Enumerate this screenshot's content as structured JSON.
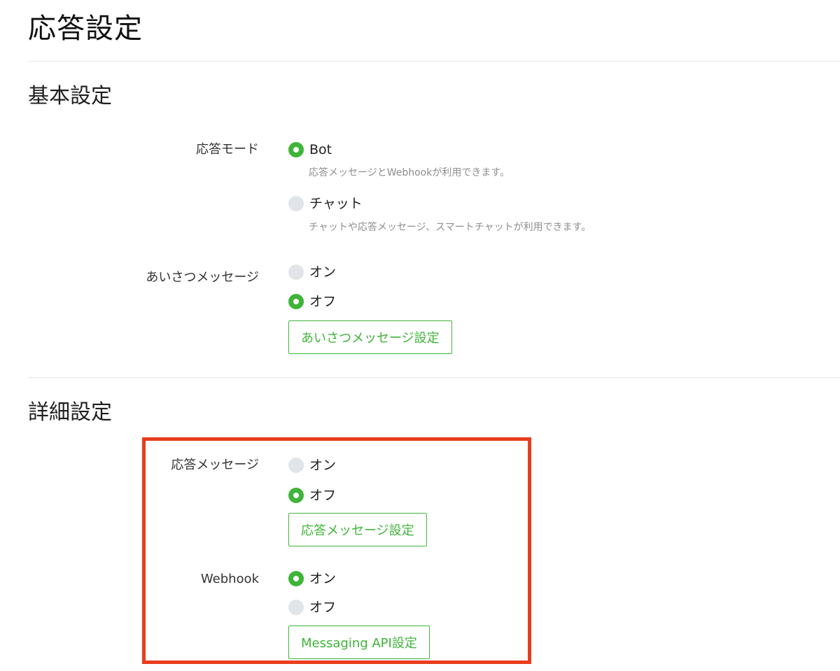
{
  "page": {
    "title": "応答設定"
  },
  "basic": {
    "title": "基本設定",
    "response_mode": {
      "label": "応答モード",
      "options": [
        {
          "label": "Bot",
          "selected": true,
          "hint": "応答メッセージとWebhookが利用できます。"
        },
        {
          "label": "チャット",
          "selected": false,
          "hint": "チャットや応答メッセージ、スマートチャットが利用できます。"
        }
      ]
    },
    "greeting": {
      "label": "あいさつメッセージ",
      "options": [
        {
          "label": "オン",
          "selected": false
        },
        {
          "label": "オフ",
          "selected": true
        }
      ],
      "button_label": "あいさつメッセージ設定"
    }
  },
  "detail": {
    "title": "詳細設定",
    "auto_reply": {
      "label": "応答メッセージ",
      "options": [
        {
          "label": "オン",
          "selected": false
        },
        {
          "label": "オフ",
          "selected": true
        }
      ],
      "button_label": "応答メッセージ設定"
    },
    "webhook": {
      "label": "Webhook",
      "options": [
        {
          "label": "オン",
          "selected": true
        },
        {
          "label": "オフ",
          "selected": false
        }
      ],
      "button_label": "Messaging API設定"
    }
  },
  "colors": {
    "accent": "#3fb439",
    "highlight": "#e83d1e",
    "radio_off": "#e1e4e8",
    "hint_text": "#8e8e8e"
  }
}
